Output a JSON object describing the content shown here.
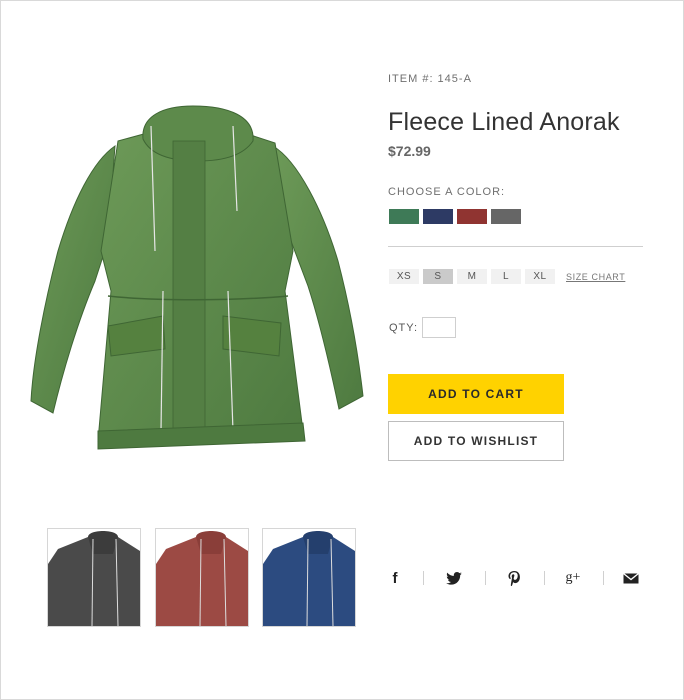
{
  "product": {
    "item_number": "ITEM #: 145-A",
    "title": "Fleece Lined Anorak",
    "price": "$72.99",
    "color_label": "CHOOSE A COLOR:",
    "colors": [
      "#3e7a57",
      "#2d3a64",
      "#903431",
      "#666666"
    ],
    "sizes": [
      "XS",
      "S",
      "M",
      "L",
      "XL"
    ],
    "selected_size": "S",
    "size_chart_label": "SIZE CHART",
    "qty_label": "QTY:",
    "qty_value": "",
    "add_to_cart_label": "ADD TO CART",
    "add_to_wishlist_label": "ADD TO WISHLIST"
  },
  "gallery": {
    "main_color": "#5b8a4c",
    "thumbnail_colors": [
      "#4a4a4a",
      "#9c4a44",
      "#2c4b80"
    ]
  },
  "social": {
    "icons": [
      "facebook-icon",
      "twitter-icon",
      "pinterest-icon",
      "google-plus-icon",
      "email-icon"
    ],
    "facebook_glyph": "f",
    "google_plus_glyph": "g+"
  },
  "theme": {
    "accent": "#ffd200"
  }
}
